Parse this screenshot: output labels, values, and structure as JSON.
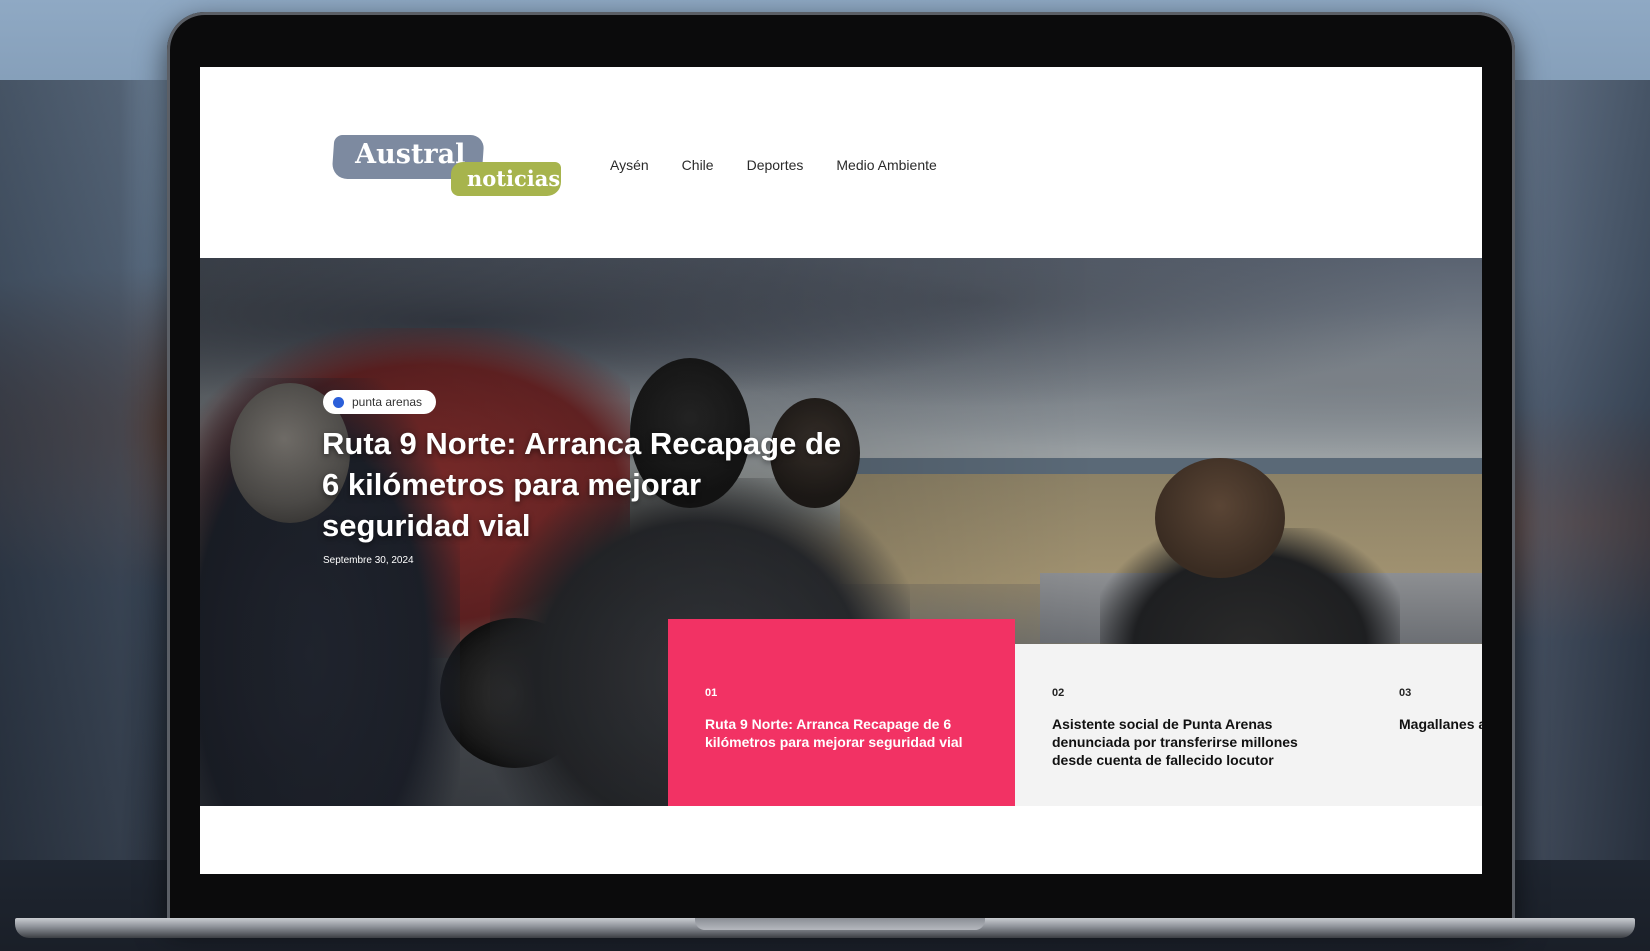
{
  "site": {
    "logo": {
      "word1": "Austral",
      "word2": "noticias"
    },
    "nav": [
      "Aysén",
      "Chile",
      "Deportes",
      "Medio Ambiente"
    ]
  },
  "hero": {
    "tag": "punta arenas",
    "title": "Ruta 9 Norte: Arranca Recapage de 6 kilómetros para mejorar seguridad vial",
    "date": "Septembre 30, 2024"
  },
  "cards": [
    {
      "num": "01",
      "title": "Ruta 9 Norte: Arranca Recapage de 6 kilómetros para mejorar seguridad vial",
      "active": true
    },
    {
      "num": "02",
      "title": "Asistente social de Punta Arenas denunciada por transferirse millones desde cuenta de fallecido locutor",
      "active": false
    },
    {
      "num": "03",
      "title": "Magallanes anular con l gratuitos",
      "active": false
    }
  ],
  "colors": {
    "accent": "#f23264",
    "tag_dot": "#2b5fd9",
    "logo_blue": "#7d8aa0",
    "logo_green": "#a7b44d"
  }
}
